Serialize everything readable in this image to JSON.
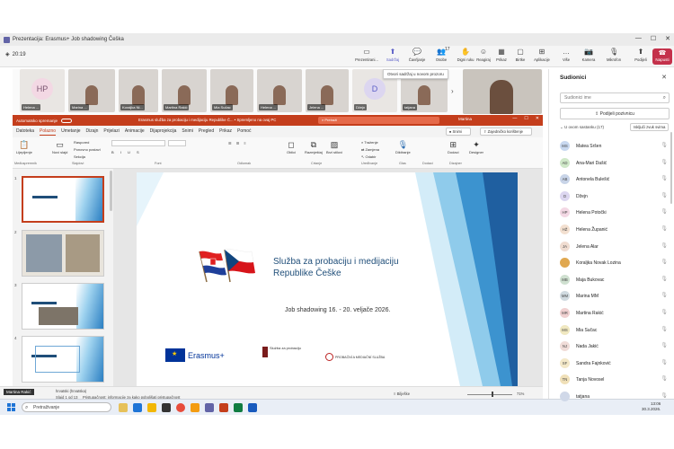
{
  "window": {
    "title": "Prezentacija: Erasmus+ Job shadowing Češka",
    "minimize": "—",
    "maximize": "☐",
    "close": "✕"
  },
  "meeting": {
    "timer": "20:19",
    "toolbar": [
      {
        "name": "present-new-window",
        "label": "Prezentirani...",
        "icon": "▭"
      },
      {
        "name": "share",
        "label": "Sadržaj",
        "icon": "⬆",
        "active": true
      },
      {
        "name": "chat",
        "label": "Čavrljanje",
        "icon": "💬"
      },
      {
        "name": "people",
        "label": "Osobe",
        "icon": "👥",
        "badge": "17"
      },
      {
        "name": "raise-hand",
        "label": "Digni ruku",
        "icon": "✋"
      },
      {
        "name": "react",
        "label": "Reagiraj",
        "icon": "☺"
      },
      {
        "name": "view",
        "label": "Prikaz",
        "icon": "▦"
      },
      {
        "name": "rooms",
        "label": "Birtke",
        "icon": "▢"
      },
      {
        "name": "apps",
        "label": "Aplikacije",
        "icon": "⊞"
      },
      {
        "name": "more",
        "label": "Više",
        "icon": "…"
      },
      {
        "name": "camera",
        "label": "Kamera",
        "icon": "📷"
      },
      {
        "name": "mic",
        "label": "Mikrofon",
        "icon": "🎙"
      },
      {
        "name": "share-screen",
        "label": "Podijeli",
        "icon": "⬆"
      }
    ],
    "leave_label": "Napusti",
    "tooltip": "Otvori sadržaj u novom prozoru"
  },
  "video_strip": [
    {
      "label": "Helena ...",
      "avatar": "HP"
    },
    {
      "label": "Marina ..."
    },
    {
      "label": "Koraljka Ni..."
    },
    {
      "label": "Martina Rakić"
    },
    {
      "label": "Mia Sučac"
    },
    {
      "label": "Helena ..."
    },
    {
      "label": "Jelena ..."
    },
    {
      "label": "Džejn",
      "avatar": "D"
    },
    {
      "label": "tatjana"
    }
  ],
  "ppt": {
    "autosave": "Automatsko spremanje",
    "doc_name": "Erasmus služba za probaciju i medijaciju Republike Č... • Spremljeno na ovaj PC",
    "search": "Pretraži",
    "user": "Martina",
    "tabs": [
      "Datoteka",
      "Polazno",
      "Umetanje",
      "Dizajn",
      "Prijelazi",
      "Animacije",
      "Dijaprojekcija",
      "Snimi",
      "Pregled",
      "Prikaz",
      "Pomoć"
    ],
    "active_tab": "Polazno",
    "record_btn": "Snimi",
    "share_btn": "Zajedničko korištenje",
    "ribbon": {
      "paste": "Lijepljenje",
      "new_slide": "Novi slajd",
      "layout": "Raspored",
      "reset": "Ponovno postavi",
      "section": "Sekcija",
      "shapes": "Oblici",
      "arrange": "Razmještaj",
      "styles": "Brzi stilovi",
      "find": "Traženje",
      "replace": "Zamjena",
      "select": "Odabir",
      "dictate": "Diktiranje",
      "addins": "Dodaci",
      "designer": "Designer",
      "groups": {
        "clipboard": "Međuspremnik",
        "slides": "Slajdovi",
        "font": "Font",
        "paragraph": "Odlomak",
        "drawing": "Crtanje",
        "editing": "Uređivanje",
        "voice": "Glas",
        "addins": "Dodaci",
        "designer": "Dizajner"
      }
    },
    "slides": [
      {
        "num": "1"
      },
      {
        "num": "2"
      },
      {
        "num": "3"
      },
      {
        "num": "4"
      }
    ],
    "slide": {
      "title1": "Služba za probaciju i medijaciju",
      "title2": "Republike Češke",
      "subtitle": "Job shadowing 16. - 20. veljače 2026.",
      "erasmus": "Erasmus+",
      "logo2": "Služba za probaciju",
      "logo3": "PROBAČNÍ A MEDIAČNÍ SLUŽBA"
    },
    "status": {
      "presenter": "Martina Rakić",
      "slide_pos": "Slajd 1 od 13",
      "lang": "hrvatski (hrvatska)",
      "accessibility": "Pristupačnost: informacije za kako poboljšati pristupačnost",
      "notes": "Bilješke",
      "zoom": "71%"
    }
  },
  "taskbar": {
    "search": "Pretraživanje",
    "time": "13:06",
    "date": "30.3.2026."
  },
  "participants": {
    "title": "Sudionici",
    "search_placeholder": "Sudionici ime",
    "share_invite": "Podijeli pozivnicu",
    "section": "U ovom sastanku (17)",
    "mute_all": "Isključi zvuk svima",
    "list": [
      {
        "initials": "MS",
        "name": "Matea Sršen",
        "color": "#c8d8f0"
      },
      {
        "initials": "AD",
        "name": "Ana-Mari Dašić",
        "color": "#cfe8c8"
      },
      {
        "initials": "AB",
        "name": "Antonela Bulešić",
        "color": "#c8d4e8"
      },
      {
        "initials": "D",
        "name": "Džejn",
        "color": "#dcd6f0"
      },
      {
        "initials": "HP",
        "name": "Helena Potočki",
        "color": "#f3d8e4"
      },
      {
        "initials": "HŽ",
        "name": "Helena Županić",
        "color": "#f3e0d0"
      },
      {
        "initials": "JA",
        "name": "Jelena Alar",
        "color": "#f0dcd0"
      },
      {
        "initials": "",
        "name": "Koraljka Novak Lozina",
        "color": "#e0a850"
      },
      {
        "initials": "MB",
        "name": "Maja Bukovac",
        "color": "#cfe0d0"
      },
      {
        "initials": "MM",
        "name": "Marina MM",
        "color": "#d0dae0"
      },
      {
        "initials": "MR",
        "name": "Martina Rakić",
        "color": "#f0d0d0"
      },
      {
        "initials": "MS",
        "name": "Mia Sučac",
        "color": "#f0e8c0"
      },
      {
        "initials": "NJ",
        "name": "Nada Jakić",
        "color": "#f0dcd8"
      },
      {
        "initials": "SF",
        "name": "Sandra Fajnković",
        "color": "#f3e8c8"
      },
      {
        "initials": "TN",
        "name": "Tanja Novosel",
        "color": "#f0e0b8"
      },
      {
        "initials": "",
        "name": "tatjana",
        "color": "#d0d8e8"
      }
    ]
  }
}
